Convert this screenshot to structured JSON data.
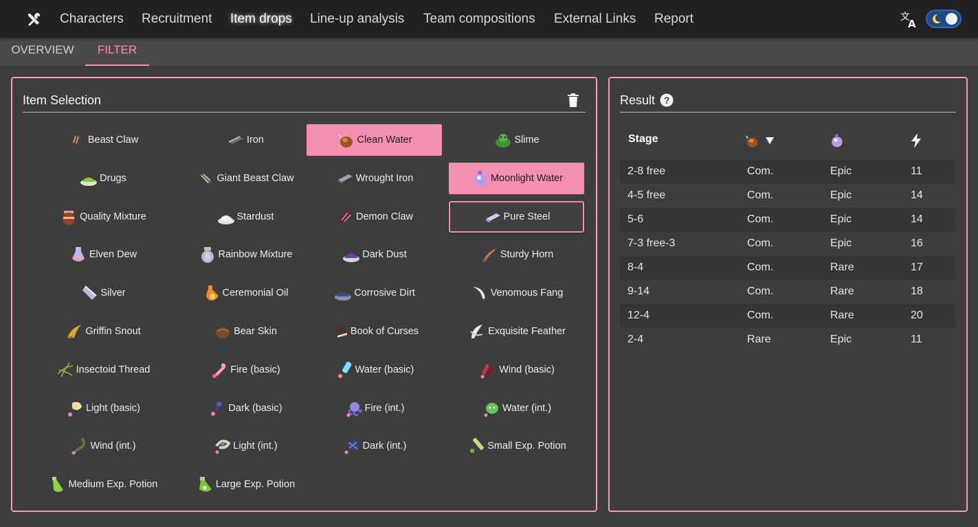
{
  "nav": {
    "items": [
      "Characters",
      "Recruitment",
      "Item drops",
      "Line-up analysis",
      "Team compositions",
      "External Links",
      "Report"
    ],
    "active": "Item drops"
  },
  "tabs": [
    "OVERVIEW",
    "FILTER"
  ],
  "active_tab": "FILTER",
  "accent_color": "#f48fb1",
  "item_selection": {
    "title": "Item Selection",
    "items": [
      {
        "label": "Beast Claw",
        "icon": "beast-claw-icon",
        "state": "none"
      },
      {
        "label": "Iron",
        "icon": "iron-icon",
        "state": "none"
      },
      {
        "label": "Clean Water",
        "icon": "clean-water-icon",
        "state": "selected"
      },
      {
        "label": "Slime",
        "icon": "slime-icon",
        "state": "none"
      },
      {
        "label": "Drugs",
        "icon": "drugs-icon",
        "state": "none"
      },
      {
        "label": "Giant Beast Claw",
        "icon": "giant-beast-claw-icon",
        "state": "none"
      },
      {
        "label": "Wrought Iron",
        "icon": "wrought-iron-icon",
        "state": "none"
      },
      {
        "label": "Moonlight Water",
        "icon": "moonlight-water-icon",
        "state": "selected"
      },
      {
        "label": "Quality Mixture",
        "icon": "quality-mixture-icon",
        "state": "none"
      },
      {
        "label": "Stardust",
        "icon": "stardust-icon",
        "state": "none"
      },
      {
        "label": "Demon Claw",
        "icon": "demon-claw-icon",
        "state": "none"
      },
      {
        "label": "Pure Steel",
        "icon": "pure-steel-icon",
        "state": "outlined"
      },
      {
        "label": "Elven Dew",
        "icon": "elven-dew-icon",
        "state": "none"
      },
      {
        "label": "Rainbow Mixture",
        "icon": "rainbow-mixture-icon",
        "state": "none"
      },
      {
        "label": "Dark Dust",
        "icon": "dark-dust-icon",
        "state": "none"
      },
      {
        "label": "Sturdy Horn",
        "icon": "sturdy-horn-icon",
        "state": "none"
      },
      {
        "label": "Silver",
        "icon": "silver-icon",
        "state": "none"
      },
      {
        "label": "Ceremonial Oil",
        "icon": "ceremonial-oil-icon",
        "state": "none"
      },
      {
        "label": "Corrosive Dirt",
        "icon": "corrosive-dirt-icon",
        "state": "none"
      },
      {
        "label": "Venomous Fang",
        "icon": "venomous-fang-icon",
        "state": "none"
      },
      {
        "label": "Griffin Snout",
        "icon": "griffin-snout-icon",
        "state": "none"
      },
      {
        "label": "Bear Skin",
        "icon": "bear-skin-icon",
        "state": "none"
      },
      {
        "label": "Book of Curses",
        "icon": "book-of-curses-icon",
        "state": "none"
      },
      {
        "label": "Exquisite Feather",
        "icon": "exquisite-feather-icon",
        "state": "none"
      },
      {
        "label": "Insectoid Thread",
        "icon": "insectoid-thread-icon",
        "state": "none"
      },
      {
        "label": "Fire (basic)",
        "icon": "fire-basic-icon",
        "state": "none"
      },
      {
        "label": "Water (basic)",
        "icon": "water-basic-icon",
        "state": "none"
      },
      {
        "label": "Wind (basic)",
        "icon": "wind-basic-icon",
        "state": "none"
      },
      {
        "label": "Light (basic)",
        "icon": "light-basic-icon",
        "state": "none"
      },
      {
        "label": "Dark (basic)",
        "icon": "dark-basic-icon",
        "state": "none"
      },
      {
        "label": "Fire (int.)",
        "icon": "fire-int-icon",
        "state": "none"
      },
      {
        "label": "Water (int.)",
        "icon": "water-int-icon",
        "state": "none"
      },
      {
        "label": "Wind (int.)",
        "icon": "wind-int-icon",
        "state": "none"
      },
      {
        "label": "Light (int.)",
        "icon": "light-int-icon",
        "state": "none"
      },
      {
        "label": "Dark (int.)",
        "icon": "dark-int-icon",
        "state": "none"
      },
      {
        "label": "Small Exp. Potion",
        "icon": "small-exp-potion-icon",
        "state": "none"
      },
      {
        "label": "Medium Exp. Potion",
        "icon": "medium-exp-potion-icon",
        "state": "none"
      },
      {
        "label": "Large Exp. Potion",
        "icon": "large-exp-potion-icon",
        "state": "none"
      }
    ]
  },
  "result": {
    "title": "Result",
    "columns": [
      {
        "label": "Stage",
        "icon": null
      },
      {
        "label": "",
        "icon": "clean-water-icon",
        "sort": "descending"
      },
      {
        "label": "",
        "icon": "moonlight-water-icon"
      },
      {
        "label": "",
        "icon": "lightning-icon"
      }
    ],
    "rows": [
      [
        "2-8 free",
        "Com.",
        "Epic",
        "11"
      ],
      [
        "4-5 free",
        "Com.",
        "Epic",
        "14"
      ],
      [
        "5-6",
        "Com.",
        "Epic",
        "14"
      ],
      [
        "7-3 free-3",
        "Com.",
        "Epic",
        "16"
      ],
      [
        "8-4",
        "Com.",
        "Rare",
        "17"
      ],
      [
        "9-14",
        "Com.",
        "Rare",
        "18"
      ],
      [
        "12-4",
        "Com.",
        "Rare",
        "20"
      ],
      [
        "2-4",
        "Rare",
        "Epic",
        "11"
      ]
    ]
  }
}
